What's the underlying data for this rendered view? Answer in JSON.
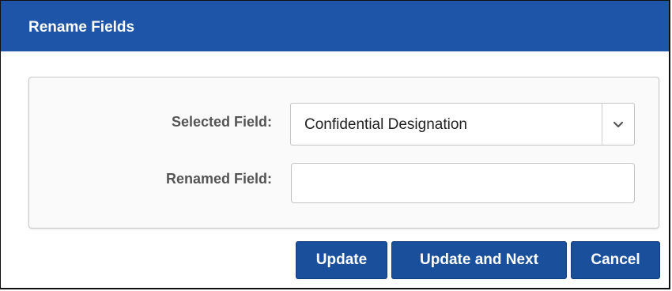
{
  "dialog": {
    "title": "Rename Fields"
  },
  "form": {
    "selected_field": {
      "label": "Selected Field:",
      "value": "Confidential Designation"
    },
    "renamed_field": {
      "label": "Renamed Field:",
      "value": "",
      "placeholder": ""
    }
  },
  "buttons": {
    "update": "Update",
    "update_and_next": "Update and Next",
    "cancel": "Cancel"
  },
  "colors": {
    "titlebar": "#1e55a8",
    "button": "#1a4f9c"
  }
}
